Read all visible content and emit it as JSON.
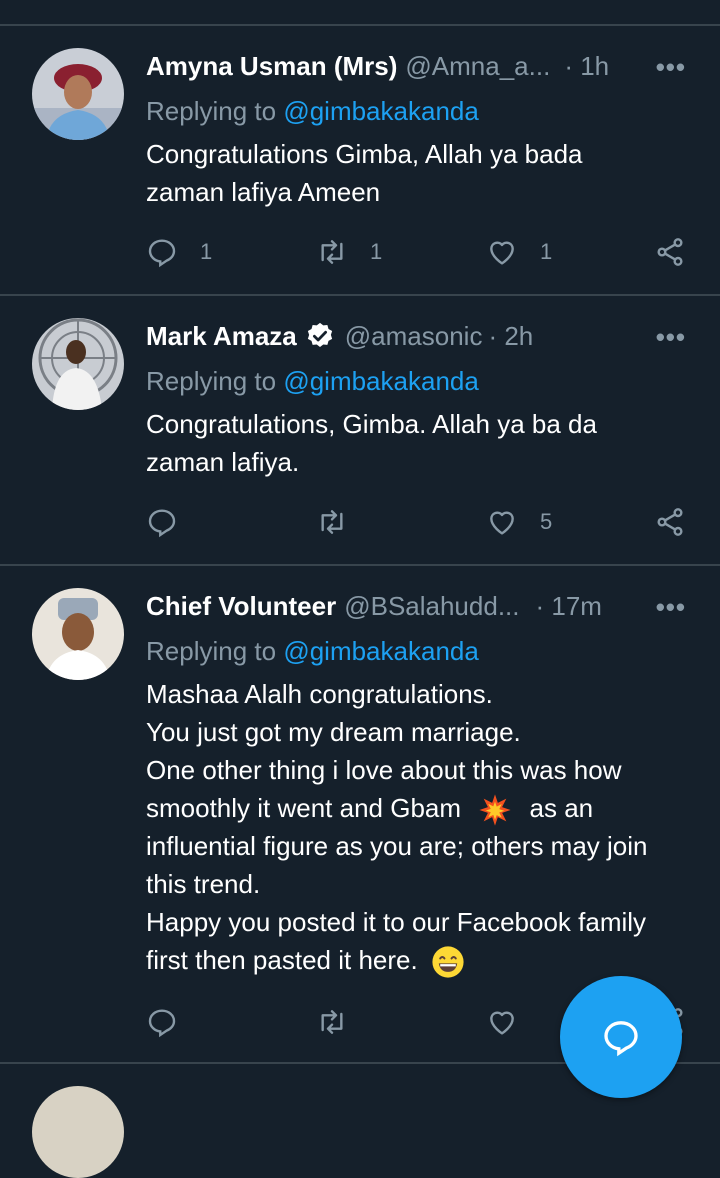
{
  "tweets": [
    {
      "name": "Amyna Usman (Mrs)",
      "handle": "@Amna_a...",
      "time": "· 1h",
      "replying_label": "Replying to",
      "replying_to": "@gimbakakanda",
      "lines": [
        "Congratulations Gimba, Allah ya bada",
        "zaman lafiya Ameen"
      ],
      "reply_count": "1",
      "retweet_count": "1",
      "like_count": "1"
    },
    {
      "name": "Mark Amaza",
      "handle": "@amasonic",
      "time": "· 2h",
      "replying_label": "Replying to",
      "replying_to": "@gimbakakanda",
      "lines": [
        "Congratulations, Gimba. Allah ya ba da",
        "zaman lafiya."
      ],
      "like_count": "5"
    },
    {
      "name": "Chief Volunteer",
      "handle": "@BSalahudd...",
      "time": "· 17m",
      "replying_label": "Replying to",
      "replying_to": "@gimbakakanda",
      "lines": [
        "Mashaa Alalh congratulations.",
        "You just got my dream marriage.",
        "One other thing i love about this was how",
        "smoothly it went and Gbam",
        "as an",
        "influential figure as you are; others may join",
        "this trend.",
        "Happy you posted it to our Facebook family",
        "first then pasted it here."
      ]
    }
  ],
  "more_symbol": "•••",
  "colors": {
    "background": "#15202b",
    "accent": "#1da1f2",
    "muted": "#8899a6",
    "divider": "#38444d"
  }
}
